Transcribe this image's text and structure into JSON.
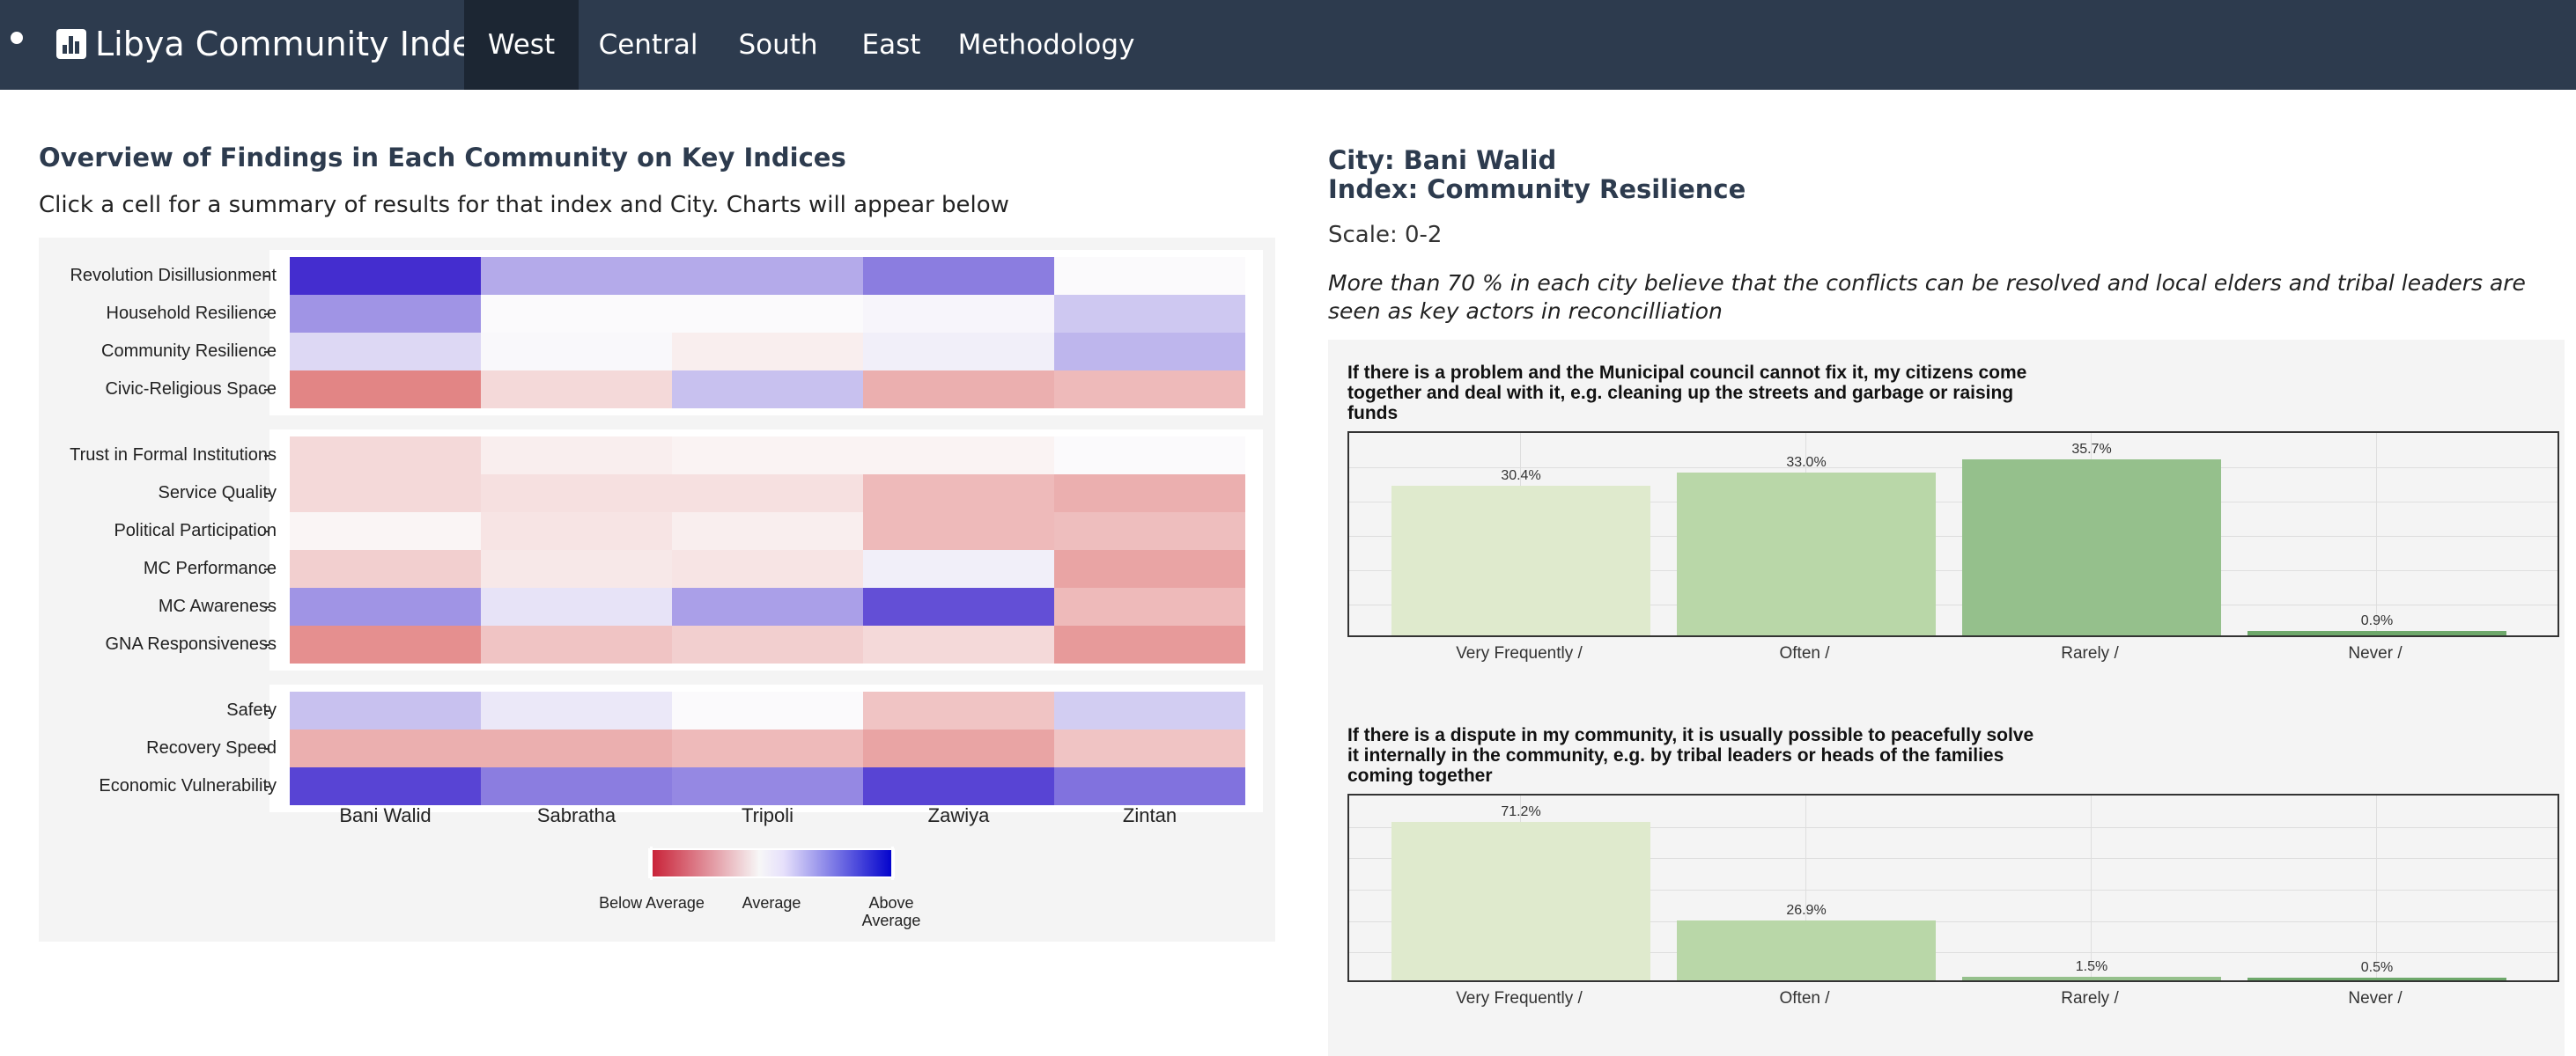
{
  "nav": {
    "brand": "Libya Community Index",
    "tabs": [
      "West",
      "Central",
      "South",
      "East",
      "Methodology"
    ],
    "active_tab": "West"
  },
  "left": {
    "title": "Overview of Findings in Each Community on Key Indices",
    "subtitle": "Click a cell for a summary of results for that index and City. Charts will appear below",
    "heatmap": {
      "chart_data": {
        "type": "heatmap",
        "columns": [
          "Bani Walid",
          "Sabratha",
          "Tripoli",
          "Zawiya",
          "Zintan"
        ],
        "groups": [
          {
            "rows": [
              "Revolution Disillusionment",
              "Household Resilience",
              "Community Resilience",
              "Civic-Religious Space"
            ],
            "values": [
              [
                0.9,
                0.35,
                0.35,
                0.55,
                0.0
              ],
              [
                0.45,
                0.0,
                0.0,
                0.02,
                0.22
              ],
              [
                0.15,
                0.01,
                -0.05,
                0.05,
                0.3
              ],
              [
                -0.55,
                -0.15,
                0.25,
                -0.35,
                -0.3
              ]
            ]
          },
          {
            "rows": [
              "Trust in Formal Institutions",
              "Service Quality",
              "Political Participation",
              "MC Performance",
              "MC Awareness",
              "GNA Responsiveness"
            ],
            "values": [
              [
                -0.15,
                -0.05,
                -0.03,
                -0.03,
                0.0
              ],
              [
                -0.15,
                -0.12,
                -0.12,
                -0.3,
                -0.35
              ],
              [
                -0.02,
                -0.1,
                -0.05,
                -0.3,
                -0.28
              ],
              [
                -0.2,
                -0.08,
                -0.1,
                0.05,
                -0.4
              ],
              [
                0.45,
                0.1,
                0.4,
                0.75,
                -0.3
              ],
              [
                -0.5,
                -0.25,
                -0.2,
                -0.15,
                -0.45
              ]
            ]
          },
          {
            "rows": [
              "Safety",
              "Recovery Speed",
              "Economic Vulnerability"
            ],
            "values": [
              [
                0.25,
                0.08,
                0.0,
                -0.25,
                0.2
              ],
              [
                -0.35,
                -0.35,
                -0.3,
                -0.4,
                -0.25
              ],
              [
                0.8,
                0.55,
                0.5,
                0.8,
                0.6
              ]
            ]
          }
        ],
        "legend": {
          "low": "Below Average",
          "mid": "Average",
          "high": "Above Average",
          "colors": {
            "low": "#c81e34",
            "mid": "#f7f7f7",
            "high": "#0000cc"
          }
        }
      }
    }
  },
  "right": {
    "city": "City: Bani Walid",
    "index": "Index: Community Resilience",
    "scale": "Scale: 0-2",
    "summary": "More than 70 % in each city believe that the conflicts can be resolved and local elders and tribal leaders are seen as key actors in reconcilliation",
    "chart_data": [
      {
        "type": "bar",
        "title": "If there is a problem and the Municipal council cannot fix it, my citizens come together and deal with it, e.g. cleaning up the streets and garbage or raising funds",
        "categories": [
          "Very Frequently /",
          "Often /",
          "Rarely /",
          "Never /"
        ],
        "values": [
          30.4,
          33.0,
          35.7,
          0.9
        ],
        "labels": [
          "30.4%",
          "33.0%",
          "35.7%",
          "0.9%"
        ],
        "colors": [
          "#dfeacd",
          "#b9d7a8",
          "#95c08c",
          "#6ea86b"
        ]
      },
      {
        "type": "bar",
        "title": "If there is a dispute in my community, it is usually possible to peacefully solve it internally in the community, e.g. by tribal leaders or heads of the families coming together",
        "categories": [
          "Very Frequently /",
          "Often /",
          "Rarely /",
          "Never /"
        ],
        "values": [
          71.2,
          26.9,
          1.5,
          0.5
        ],
        "labels": [
          "71.2%",
          "26.9%",
          "1.5%",
          "0.5%"
        ],
        "colors": [
          "#dfeacd",
          "#b9d7a8",
          "#95c08c",
          "#6ea86b"
        ]
      }
    ]
  }
}
